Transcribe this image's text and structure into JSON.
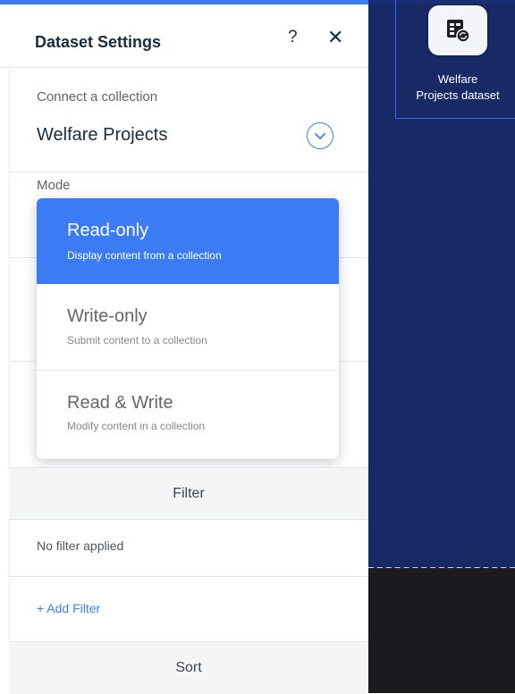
{
  "panel": {
    "title": "Dataset Settings",
    "help_icon": "?",
    "close_icon": "✕",
    "connect_label": "Connect a collection",
    "collection_value": "Welfare Projects",
    "mode_label": "Mode",
    "mode_options": [
      {
        "title": "Read-only",
        "desc": "Display content from a collection",
        "selected": true
      },
      {
        "title": "Write-only",
        "desc": "Submit content to a collection",
        "selected": false
      },
      {
        "title": "Read & Write",
        "desc": "Modify content in a collection",
        "selected": false
      }
    ],
    "filter_header": "Filter",
    "filter_status": "No filter applied",
    "add_filter": "+ Add Filter",
    "sort_header": "Sort"
  },
  "canvas": {
    "dataset_label_line1": "Welfare",
    "dataset_label_line2": "Projects dataset",
    "dataset_icon": "dataset-icon"
  },
  "colors": {
    "accent": "#3b7bf4",
    "canvas_bg": "#172a66",
    "text_dark": "#162d3d"
  }
}
